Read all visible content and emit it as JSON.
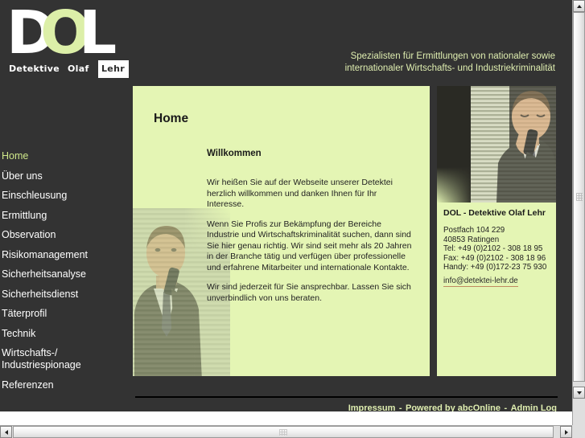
{
  "logo": {
    "letters": {
      "d": "D",
      "o": "O",
      "l": "L"
    },
    "words": {
      "detektive": "Detektive",
      "olaf": "Olaf",
      "lehr": "Lehr"
    }
  },
  "header": {
    "tagline_line1": "Spezialisten für Ermittlungen von nationaler sowie",
    "tagline_line2": "internationaler Wirtschafts- und Industriekriminalität"
  },
  "sidebar": {
    "items": [
      {
        "label": "Home",
        "active": true
      },
      {
        "label": "Über uns",
        "active": false
      },
      {
        "label": "Einschleusung",
        "active": false
      },
      {
        "label": "Ermittlung",
        "active": false
      },
      {
        "label": "Observation",
        "active": false
      },
      {
        "label": "Risikomanagement",
        "active": false
      },
      {
        "label": "Sicherheitsanalyse",
        "active": false
      },
      {
        "label": "Sicherheitsdienst",
        "active": false
      },
      {
        "label": "Täterprofil",
        "active": false
      },
      {
        "label": "Technik",
        "active": false
      },
      {
        "label": "Wirtschafts-/",
        "label2": "Industriespionage",
        "active": false
      },
      {
        "label": "Referenzen",
        "active": false
      }
    ]
  },
  "main": {
    "page_title": "Home",
    "heading": "Willkommen",
    "paragraphs": [
      "Wir heißen Sie auf der Webseite unserer Detektei herzlich willkommen und danken Ihnen für Ihr Interesse.",
      "Wenn Sie Profis zur Bekämpfung der Bereiche Industrie und Wirtschaftskriminalität suchen, dann sind Sie hier genau richtig. Wir sind seit mehr als 20 Jahren in der Branche tätig und verfügen über professionelle und erfahrene Mitarbeiter und internationale Kontakte.",
      "Wir sind jederzeit für Sie ansprechbar. Lassen Sie sich unverbindlich von uns beraten."
    ],
    "photo_alt": "man-on-phone-behind-blinds"
  },
  "contact": {
    "title": "DOL - Detektive Olaf Lehr",
    "lines": [
      "Postfach 104 229",
      "40853 Ratingen",
      "Tel:  +49 (0)2102 - 308 18 95",
      "Fax: +49 (0)2102 - 308 18 96",
      "Handy: +49 (0)172-23 75 930"
    ],
    "email": "info@detektei-lehr.de",
    "photo_alt": "man-on-phone-behind-blinds"
  },
  "footer": {
    "impressum": "Impressum",
    "sep1": "-",
    "powered_by": "Powered by abcOnline",
    "sep2": "-",
    "admin": "Admin Log"
  },
  "colors": {
    "page_background": "#333333",
    "panel_background": "#e4f5b4",
    "accent_text": "#dfeeb0",
    "nav_active": "#cfe88a",
    "logo_accent": "#dcefa8"
  }
}
